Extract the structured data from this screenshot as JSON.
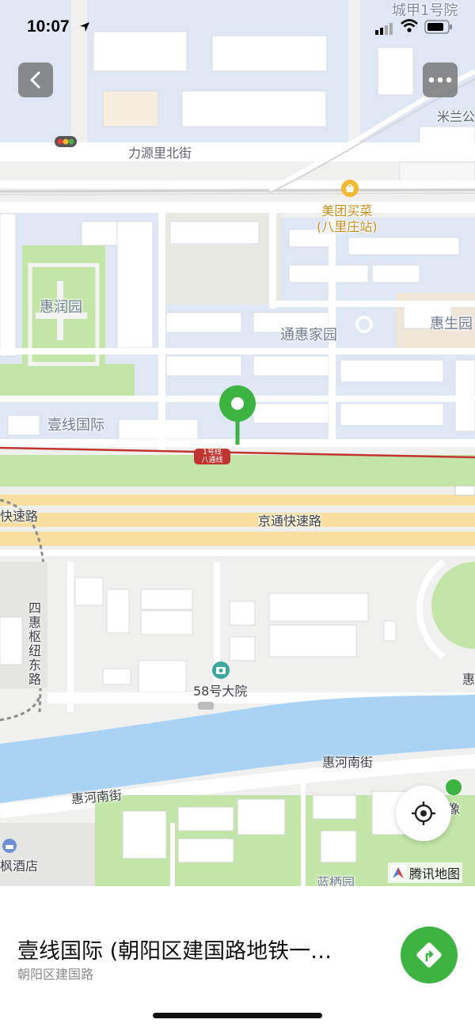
{
  "status_bar": {
    "time": "10:07"
  },
  "map": {
    "labels": {
      "street_lyl": "力源里北街",
      "poi_meituan": "美团买菜\n(八里庄站)",
      "area_huirun": "惠润园",
      "area_tonghui": "通惠家园",
      "area_huisheng": "惠生园",
      "area_yixian": "壹线国际",
      "road_jingtong": "京通快速路",
      "road_kuaisu_left": "快速路",
      "road_sihui": "四惠枢纽东路",
      "poi_58": "58号大院",
      "street_huihe_right": "惠河南街",
      "street_huihe_left": "惠河南街",
      "top_chengjia": "城甲1号院",
      "top_milan": "米兰公",
      "hotel_feng": "枫酒店",
      "edge_hui": "惠",
      "edge_xiang": "像",
      "bottom_partial": "蓝栖园",
      "metro_badge_line": "1号线",
      "metro_badge_sub": "八通线"
    },
    "brand": "腾讯地图",
    "icons": [
      "back-icon",
      "more-icon",
      "locate-icon",
      "location-pin-icon",
      "traffic-light-icon",
      "shopping-icon",
      "camera-icon",
      "tencent-map-logo-icon",
      "route-icon"
    ]
  },
  "place": {
    "title": "壹线国际 (朝阳区建国路地铁一…",
    "subtitle": "朝阳区建国路"
  },
  "colors": {
    "pin_green": "#3db342",
    "route_button": "#3db342",
    "water": "#a9d3f5",
    "park": "#c3e6a8",
    "expressway": "#f8dfa0",
    "metro_line": "#c0352f",
    "poi_label": "#c9901e"
  }
}
